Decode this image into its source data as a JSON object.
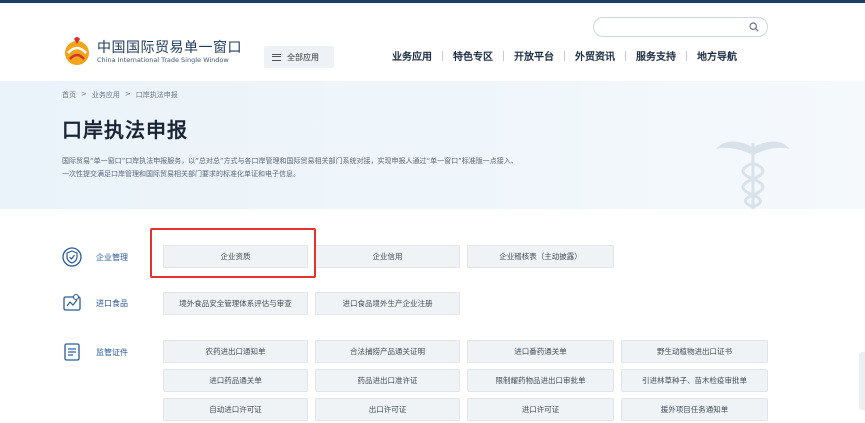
{
  "site": {
    "name_cn": "中国国际贸易单一窗口",
    "name_en": "China International Trade Single Window"
  },
  "header": {
    "all_apps_label": "全部应用",
    "search_placeholder": "",
    "nav": [
      "业务应用",
      "特色专区",
      "开放平台",
      "外贸资讯",
      "服务支持",
      "地方导航"
    ]
  },
  "breadcrumb": [
    "首页",
    ">",
    "业务应用",
    ">",
    "口岸执法申报"
  ],
  "hero": {
    "title": "口岸执法申报",
    "desc_line1": "国际贸易“单一窗口”口岸执法申报服务，以“总对总”方式与各口岸管理和国际贸易相关部门系统对接，实现申报人通过“单一窗口”标准版一点接入、",
    "desc_line2": "一次性提交满足口岸管理和国际贸易相关部门要求的标准化单证和电子信息。"
  },
  "sections": [
    {
      "label": "企业管理",
      "icon": "shield-icon",
      "tiles": [
        "企业资质",
        "企业信用",
        "企业稽核表（主动披露）"
      ]
    },
    {
      "label": "进口食品",
      "icon": "food-import-icon",
      "tiles": [
        "境外食品安全管理体系评估与审查",
        "进口食品境外生产企业注册"
      ]
    },
    {
      "label": "监管证件",
      "icon": "certificate-icon",
      "tiles": [
        "农药进出口通知单",
        "合法捕捞产品通关证明",
        "进口番药通关单",
        "野生动植物进出口证书",
        "进口药品通关单",
        "药品进出口准许证",
        "限制耀药物品进出口审批单",
        "引进林草种子、苗木检疫审批单",
        "自动进口许可证",
        "出口许可证",
        "进口许可证",
        "援外项目任务通知单"
      ]
    }
  ],
  "colors": {
    "nav_text": "#1d2f45",
    "section_label": "#2a5a96",
    "highlight_border": "#e5322d",
    "hero_bg": "#eaf3fa"
  }
}
